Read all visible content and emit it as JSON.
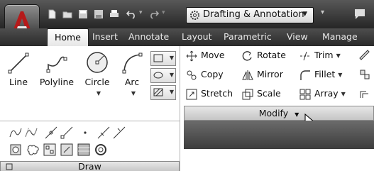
{
  "workspace": {
    "name": "Drafting & Annotation"
  },
  "tabs": [
    "Home",
    "Insert",
    "Annotate",
    "Layout",
    "Parametric",
    "View",
    "Manage"
  ],
  "draw_panel": {
    "title": "Draw",
    "big_tools": [
      {
        "label": "Line",
        "icon": "line-icon",
        "has_dropdown": false
      },
      {
        "label": "Polyline",
        "icon": "polyline-icon",
        "has_dropdown": false
      },
      {
        "label": "Circle",
        "icon": "circle-icon",
        "has_dropdown": true
      },
      {
        "label": "Arc",
        "icon": "arc-icon",
        "has_dropdown": true
      }
    ]
  },
  "modify_panel": {
    "title": "Modify",
    "tools": [
      {
        "label": "Move",
        "icon": "move-icon",
        "has_dropdown": false
      },
      {
        "label": "Rotate",
        "icon": "rotate-icon",
        "has_dropdown": false
      },
      {
        "label": "Trim",
        "icon": "trim-icon",
        "has_dropdown": true
      },
      {
        "label": "Copy",
        "icon": "copy-icon",
        "has_dropdown": false
      },
      {
        "label": "Mirror",
        "icon": "mirror-icon",
        "has_dropdown": false
      },
      {
        "label": "Fillet",
        "icon": "fillet-icon",
        "has_dropdown": true
      },
      {
        "label": "Stretch",
        "icon": "stretch-icon",
        "has_dropdown": false
      },
      {
        "label": "Scale",
        "icon": "scale-icon",
        "has_dropdown": false
      },
      {
        "label": "Array",
        "icon": "array-icon",
        "has_dropdown": true
      }
    ]
  },
  "colors": {
    "ribbon_dark": "#2e2e2e",
    "panel_title": "#d2d2d2",
    "active_tab": "#ffffff"
  }
}
